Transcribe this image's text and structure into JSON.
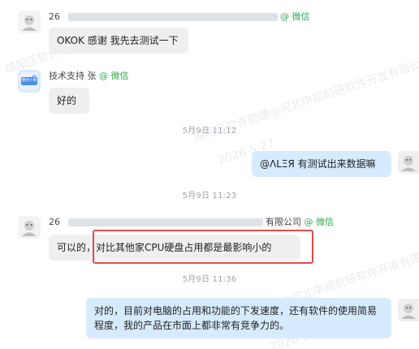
{
  "watermark": {
    "text_1": "城阳区软件助理",
    "text_2": "城阳区软件助理@河北中视前研软件开发有限公司",
    "date": "2026-5-27"
  },
  "colors": {
    "accent_wechat": "#2fa94e",
    "bubble_left": "#efefef",
    "bubble_right": "#d7ebff",
    "timestamp": "#a0a4a8",
    "highlight": "#e24b4b"
  },
  "icons": {
    "avatar_user": "avatar-icon",
    "avatar_support": "support-avatar-icon"
  },
  "messages": [
    {
      "side": "left",
      "avatar": "avatar-1",
      "sender_id": "26",
      "sender_suffix": "@ 微信",
      "text": "OKOK 感谢 我先去测试一下"
    },
    {
      "side": "left",
      "avatar": "avatar-2",
      "sender": "技术支持 张",
      "sender_suffix": "@ 微信",
      "text": "好的"
    },
    {
      "timestamp": "5月9日 11:12"
    },
    {
      "side": "right",
      "avatar": "avatar-3",
      "text": "@ΛLΞЯ 有测试出来数据嘛"
    },
    {
      "timestamp": "5月9日 11:23"
    },
    {
      "side": "left",
      "avatar": "avatar-4",
      "sender_id": "26",
      "sender_company": "有限公司",
      "sender_suffix": "@ 微信",
      "text": "可以的，对比其他家CPU硬盘占用都是最影响小的"
    },
    {
      "timestamp": "5月9日 11:36"
    },
    {
      "side": "right",
      "avatar": "avatar-5",
      "text": "对的，目前对电脑的占用和功能的下发速度，还有软件的使用简易程度，我的产品在市面上都非常有竞争力的。"
    }
  ],
  "support_logo_text": "豫合小张"
}
